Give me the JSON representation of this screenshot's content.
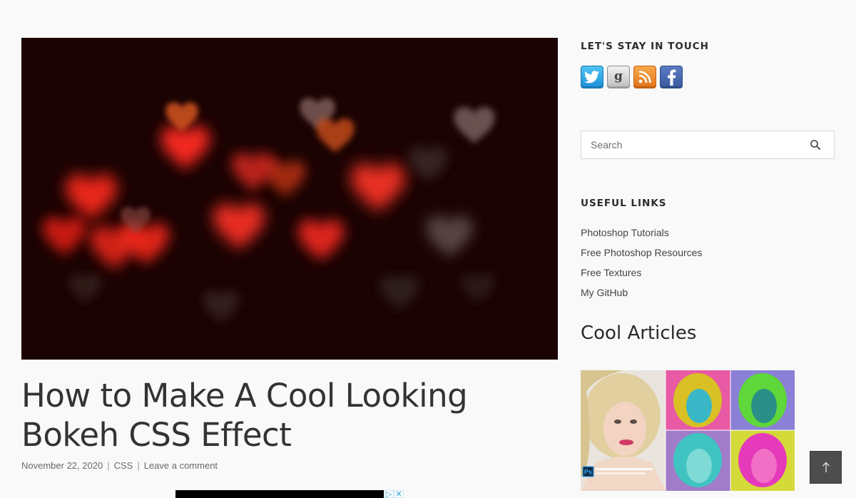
{
  "post": {
    "title": "How to Make A Cool Looking Bokeh CSS Effect",
    "date": "November 22, 2020",
    "category": "CSS",
    "comment_link": "Leave a comment",
    "separator": "|"
  },
  "sidebar": {
    "stay_in_touch_title": "LET'S STAY IN TOUCH",
    "social": [
      {
        "icon": "twitter-icon",
        "color": "#1d8fd6"
      },
      {
        "icon": "goodreads-icon",
        "color": "#bdbdbd"
      },
      {
        "icon": "rss-icon",
        "color": "#e1731b"
      },
      {
        "icon": "facebook-icon",
        "color": "#3a5a9f"
      }
    ],
    "search": {
      "placeholder": "Search",
      "icon": "search-icon"
    },
    "useful_links_title": "USEFUL LINKS",
    "useful_links": [
      {
        "label": "Photoshop Tutorials"
      },
      {
        "label": "Free Photoshop Resources"
      },
      {
        "label": "Free Textures"
      },
      {
        "label": "My GitHub"
      }
    ],
    "cool_articles_title": "Cool Articles"
  },
  "thumbnail": {
    "logo_mark": "Ps"
  },
  "back_to_top": {
    "icon": "arrow-up-icon"
  }
}
